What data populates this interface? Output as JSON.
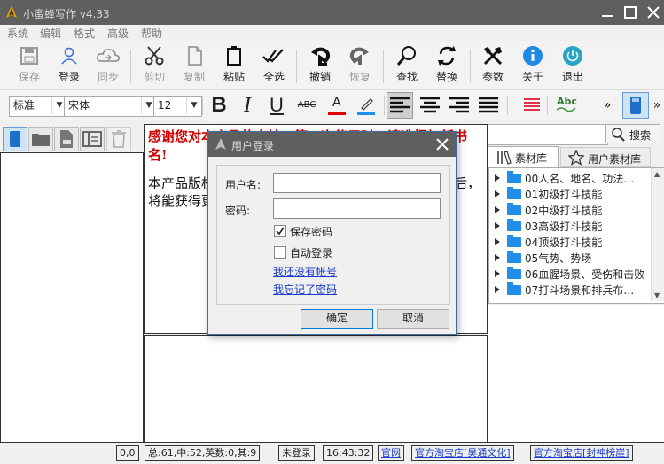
{
  "window": {
    "title": "小蜜蜂写作 v4.33"
  },
  "menu": [
    "系统",
    "编辑",
    "格式",
    "高级",
    "帮助"
  ],
  "toolbar": {
    "save": "保存",
    "login": "登录",
    "sync": "同步",
    "cut": "剪切",
    "copy": "复制",
    "paste": "粘贴",
    "select_all": "全选",
    "undo": "撤销",
    "redo": "恢复",
    "find": "查找",
    "replace": "替换",
    "params": "参数",
    "about": "关于",
    "exit": "退出"
  },
  "format": {
    "style": "标准",
    "font": "宋体",
    "size": "12",
    "bold": "B",
    "italic": "I",
    "underline": "U",
    "strike": "ABC",
    "font_color": "A",
    "spell": "Abc",
    "more": "»",
    "colors": {
      "font_color_bar": "#e00000",
      "highlight_bar": "#1e8ee8",
      "align_list": "#e0304a"
    }
  },
  "editor": {
    "heading": "感谢您对本产品的支持，第一次使用时，请选择加新书名!",
    "body": "本产品版权所有，未经授权不得用于商业目的，授权后，将能获得更多的功能。"
  },
  "right": {
    "search_placeholder": "",
    "search_button": "搜索",
    "tab_library": "素材库",
    "tab_user_library": "用户素材库",
    "items": [
      "00人名、地名、功法…",
      "01初级打斗技能",
      "02中级打斗技能",
      "03高级打斗技能",
      "04顶级打斗技能",
      "05气势、势场",
      "06血腥场景、受伤和击败",
      "07打斗场景和排兵布…"
    ]
  },
  "status": {
    "pos": "0,0",
    "counts": "总:61,中:52,英数:0,其:9",
    "login": "未登录",
    "time": "16:43:32",
    "site": "官网",
    "shop1": "官方淘宝店[昊通文化]",
    "shop2": "官方淘宝店[封神榜崖]"
  },
  "dialog": {
    "title": "用户登录",
    "username_label": "用户名:",
    "username_value": "",
    "password_label": "密码:",
    "password_value": "",
    "save_password": "保存密码",
    "save_password_checked": true,
    "auto_login": "自动登录",
    "auto_login_checked": false,
    "no_account": "我还没有帐号",
    "forgot": "我忘记了密码",
    "ok": "确定",
    "cancel": "取消"
  }
}
